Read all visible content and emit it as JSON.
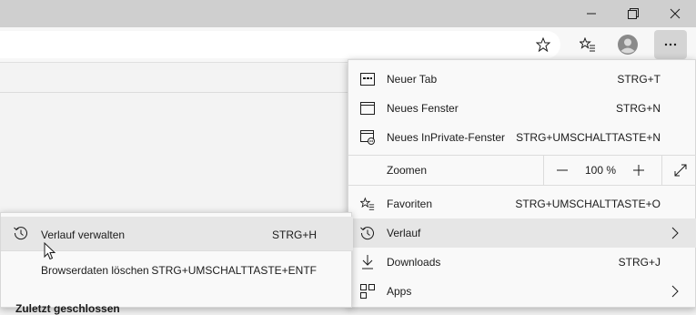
{
  "window": {
    "minimize_icon": "minimize-icon",
    "restore_icon": "restore-icon",
    "close_icon": "close-icon"
  },
  "toolbar": {
    "address_value": "",
    "favorite_star_icon": "star-outline-icon",
    "favorites_icon": "favorites-list-icon",
    "profile_icon": "profile-avatar-icon",
    "more_icon": "more-dots-icon"
  },
  "menu": {
    "items": [
      {
        "label": "Neuer Tab",
        "shortcut": "STRG+T",
        "icon": "new-tab-icon"
      },
      {
        "label": "Neues Fenster",
        "shortcut": "STRG+N",
        "icon": "new-window-icon"
      },
      {
        "label": "Neues InPrivate-Fenster",
        "shortcut": "STRG+UMSCHALTTASTE+N",
        "icon": "inprivate-window-icon"
      },
      {
        "label": "Zoomen",
        "zoom_value": "100 %",
        "minus": "−",
        "plus": "+"
      },
      {
        "label": "Favoriten",
        "shortcut": "STRG+UMSCHALTTASTE+O",
        "icon": "favorites-icon"
      },
      {
        "label": "Verlauf",
        "icon": "history-icon"
      },
      {
        "label": "Downloads",
        "shortcut": "STRG+J",
        "icon": "download-icon"
      },
      {
        "label": "Apps",
        "icon": "apps-icon"
      }
    ]
  },
  "submenu": {
    "items": [
      {
        "label": "Verlauf verwalten",
        "shortcut": "STRG+H",
        "icon": "history-icon"
      },
      {
        "label": "Browserdaten löschen",
        "shortcut": "STRG+UMSCHALTTASTE+ENTF"
      }
    ],
    "section_heading": "Zuletzt geschlossen"
  },
  "colors": {
    "titlebar": "#cfcfcf",
    "menu_bg": "#f9f9f9",
    "hover": "#e6e6e6",
    "text": "#1b1b1b"
  }
}
